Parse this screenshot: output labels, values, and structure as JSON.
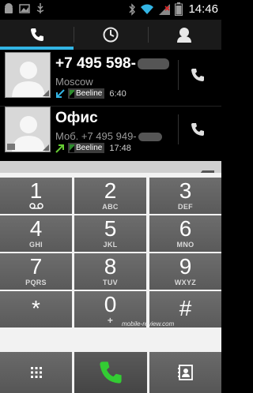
{
  "status_bar": {
    "time": "14:46",
    "left_icons": [
      "android-icon",
      "image-icon",
      "usb-icon"
    ],
    "right_icons": [
      "bluetooth-icon",
      "wifi-icon",
      "signal-icon",
      "battery-icon"
    ]
  },
  "tabs": [
    {
      "name": "phone",
      "icon": "phone-icon",
      "active": true
    },
    {
      "name": "history",
      "icon": "clock-icon",
      "active": false
    },
    {
      "name": "contacts",
      "icon": "person-icon",
      "active": false
    }
  ],
  "call_log": [
    {
      "name": "+7 495 598-",
      "subtitle": "Moscow",
      "direction": "incoming",
      "sim": "Beeline",
      "time": "6:40"
    },
    {
      "name": "Офис",
      "subtitle": "Моб. +7 495 949-",
      "direction": "outgoing",
      "sim": "Beeline",
      "time": "17:48"
    }
  ],
  "keys": [
    {
      "digit": "1",
      "letters": ""
    },
    {
      "digit": "2",
      "letters": "ABC"
    },
    {
      "digit": "3",
      "letters": "DEF"
    },
    {
      "digit": "4",
      "letters": "GHI"
    },
    {
      "digit": "5",
      "letters": "JKL"
    },
    {
      "digit": "6",
      "letters": "MNO"
    },
    {
      "digit": "7",
      "letters": "PQRS"
    },
    {
      "digit": "8",
      "letters": "TUV"
    },
    {
      "digit": "9",
      "letters": "WXYZ"
    },
    {
      "digit": "*",
      "letters": ""
    },
    {
      "digit": "0",
      "letters": "+"
    },
    {
      "digit": "#",
      "letters": ""
    }
  ],
  "watermark": "mobile-review.com",
  "colors": {
    "accent": "#33b5e5",
    "call_green": "#33cc33",
    "incoming_arrow": "#33b5e5",
    "outgoing_arrow": "#66cc33"
  }
}
